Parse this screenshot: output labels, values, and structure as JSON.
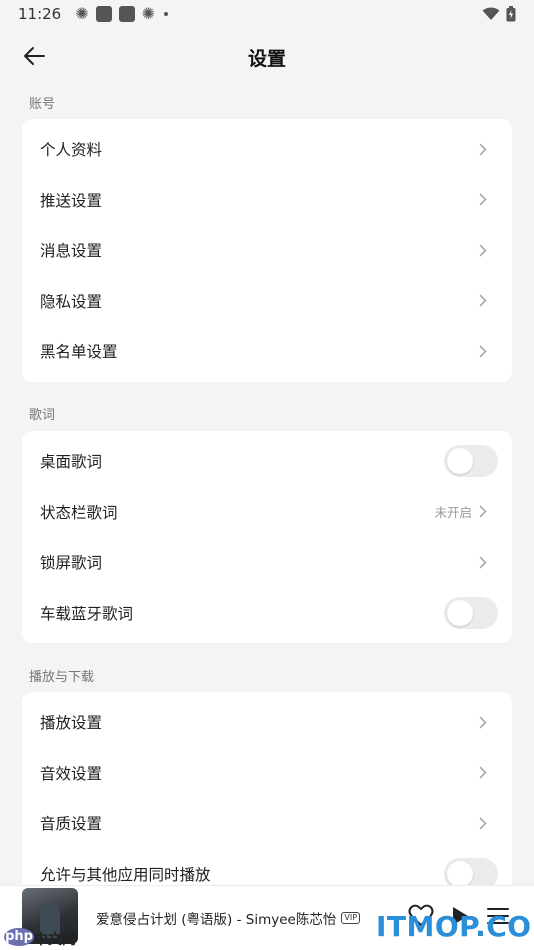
{
  "status_bar": {
    "time": "11:26"
  },
  "header": {
    "title": "设置"
  },
  "sections": {
    "account": {
      "label": "账号",
      "items": [
        {
          "label": "个人资料"
        },
        {
          "label": "推送设置"
        },
        {
          "label": "消息设置"
        },
        {
          "label": "隐私设置"
        },
        {
          "label": "黑名单设置"
        }
      ]
    },
    "lyrics": {
      "label": "歌词",
      "items": [
        {
          "label": "桌面歌词",
          "control": "toggle",
          "on": false
        },
        {
          "label": "状态栏歌词",
          "value": "未开启"
        },
        {
          "label": "锁屏歌词"
        },
        {
          "label": "车载蓝牙歌词",
          "control": "toggle",
          "on": false
        }
      ]
    },
    "playback": {
      "label": "播放与下载",
      "items": [
        {
          "label": "播放设置"
        },
        {
          "label": "音效设置"
        },
        {
          "label": "音质设置"
        },
        {
          "label": "允许与其他应用同时播放",
          "control": "toggle",
          "on": false
        }
      ]
    }
  },
  "player": {
    "song": "爱意侵占计划 (粤语版) - Simyee陈芯怡",
    "badge": "VIP"
  },
  "watermarks": {
    "php_logo": "php",
    "php_cn": "中文网",
    "itmop": "ITMOP.COM"
  }
}
